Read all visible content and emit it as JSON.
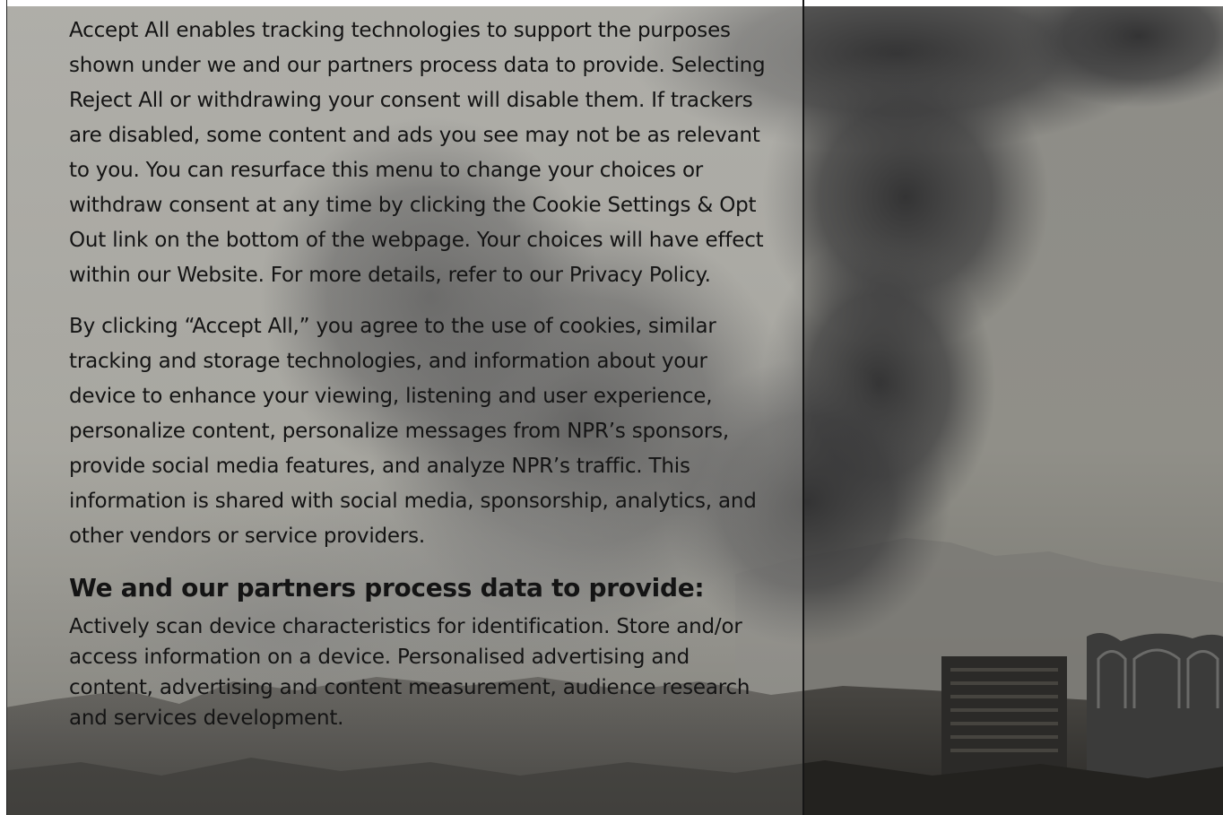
{
  "consent": {
    "paragraph_1": "Accept All enables tracking technologies to support the purposes shown under we and our partners process data to provide. Selecting Reject All or withdrawing your consent will disable them. If trackers are disabled, some content and ads you see may not be as relevant to you. You can resurface this menu to change your choices or withdraw consent at any time by clicking the Cookie Settings & Opt Out link on the bottom of the webpage. Your choices will have effect within our Website. For more details, refer to our Privacy Policy.",
    "paragraph_2": "By clicking “Accept All,” you agree to the use of cookies, similar tracking and storage technologies, and information about your device to enhance your viewing, listening and user experience, personalize content, personalize messages from NPR’s sponsors, provide social media features, and analyze NPR’s traffic. This information is shared with social media, sponsorship, analytics, and other vendors or service providers.",
    "heading": "We and our partners process data to provide:",
    "paragraph_3": "Actively scan device characteristics for identification. Store and/or access information on a device. Personalised advertising and content, advertising and content measurement, audience research and services development."
  },
  "colors": {
    "text": "#141414",
    "sky": "#8a8984",
    "smoke": "#3f3f3f",
    "divider": "#161616"
  }
}
